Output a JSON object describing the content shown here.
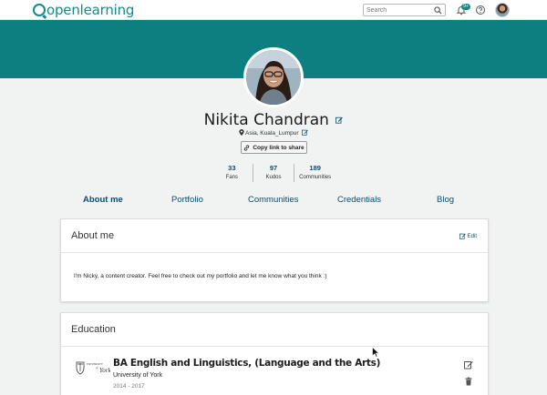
{
  "header": {
    "logo_text": "openlearning",
    "search_placeholder": "Search",
    "notification_badge": "9+"
  },
  "profile": {
    "name": "Nikita Chandran",
    "location": "Asia, Kuala_Lumpur",
    "copy_link_label": "Copy link to share",
    "stats": [
      {
        "value": "33",
        "label": "Fans"
      },
      {
        "value": "97",
        "label": "Kudos"
      },
      {
        "value": "189",
        "label": "Communities"
      }
    ]
  },
  "tabs": [
    {
      "label": "About me",
      "active": true
    },
    {
      "label": "Portfolio",
      "active": false
    },
    {
      "label": "Communities",
      "active": false
    },
    {
      "label": "Credentials",
      "active": false
    },
    {
      "label": "Blog",
      "active": false
    }
  ],
  "about": {
    "title": "About me",
    "edit_label": "Edit",
    "text": "I'm Nicky, a content creator. Feel free to check out my portfolio and let me know what you think :)"
  },
  "education": {
    "title": "Education",
    "entries": [
      {
        "degree": "BA English and Linguistics, (Language and the Arts)",
        "school": "University of York",
        "years": "2014 - 2017",
        "logo_text_top": "UNIVERSITY",
        "logo_text_sub": "of",
        "logo_text_main": "York"
      }
    ]
  },
  "colors": {
    "brand_teal": "#0e7f80",
    "link_navy": "#0b4d6e"
  },
  "icons": [
    "search-icon",
    "bell-icon",
    "help-icon",
    "edit-icon",
    "map-pin-icon",
    "link-icon",
    "trash-icon",
    "cursor-icon"
  ]
}
